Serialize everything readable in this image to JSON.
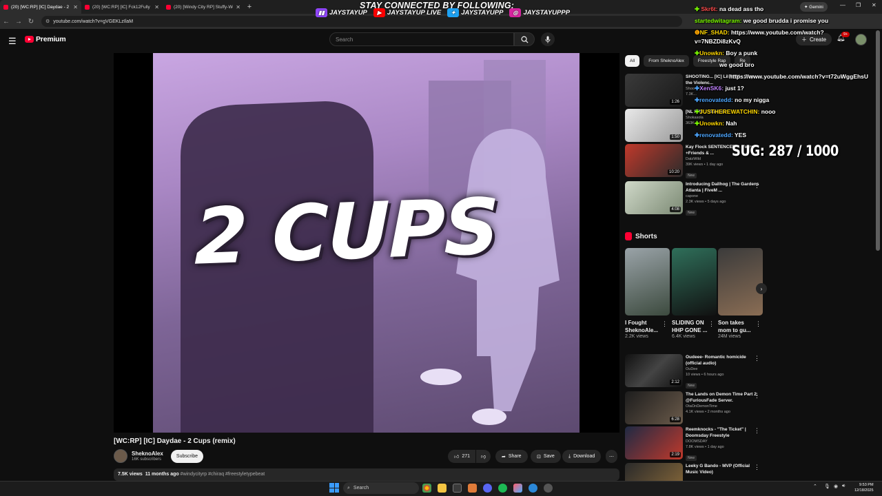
{
  "browser": {
    "tabs": [
      {
        "title": "(20) [WC:RP] [IC] Daydae - 2 Cu",
        "active": true
      },
      {
        "title": "(20) [WC:RP] [IC] Fck12Fully X",
        "active": false
      },
      {
        "title": "(20) [Windy City RP] Stuffy-We",
        "active": false
      }
    ],
    "url": "youtube.com/watch?v=gVGEKLzIlaM",
    "gemini_label": "Gemini"
  },
  "overlay": {
    "title": "STAY CONNECTED BY FOLLOWING:",
    "socials": [
      {
        "icon": "twitch-icon",
        "label": "JAYSTAYUP",
        "color": "#9146ff"
      },
      {
        "icon": "youtube-icon",
        "label": "JAYSTAYUP LIVE",
        "color": "#ff0000"
      },
      {
        "icon": "twitter-icon",
        "label": "JAYSTAYUPP",
        "color": "#1da1f2"
      },
      {
        "icon": "instagram-icon",
        "label": "JAYSTAYUPPP",
        "color": "#d6249f"
      }
    ],
    "suggestion": "SUG:  287 / 1000",
    "chat": [
      {
        "user": "Skr6t:",
        "msg": "na dead ass tho",
        "color": "#ff4d4d"
      },
      {
        "user": "startedwitagram:",
        "msg": "we good brudda i promise you",
        "color": "#7cfc00"
      },
      {
        "user": "NF_SHAD:",
        "msg": "https://www.youtube.com/watch?",
        "color": "#ffd700"
      },
      {
        "user": "",
        "msg": "v=7NBZDi8zKvQ",
        "color": "#ffffff"
      },
      {
        "user": "Unowkn:",
        "msg": "Boy a punk",
        "color": "#ffd700"
      },
      {
        "user": "",
        "msg": "we good bro",
        "color": "#ffffff"
      },
      {
        "user": "",
        "msg": "https://www.youtube.com/watch?v=t72uWggEhsU",
        "color": "#ffffff"
      },
      {
        "user": "XenSK6:",
        "msg": "just 1?",
        "color": "#c080ff"
      },
      {
        "user": "renovatedd:",
        "msg": "no my nigga",
        "color": "#4da6ff"
      },
      {
        "user": "JUSTHEREWATCHIN:",
        "msg": "nooo",
        "color": "#ffd700"
      },
      {
        "user": "Unowkn:",
        "msg": "Nah",
        "color": "#ffd700"
      },
      {
        "user": "renovatedd:",
        "msg": "YES",
        "color": "#4da6ff"
      }
    ]
  },
  "youtube": {
    "logo_label": "Premium",
    "search_placeholder": "Search",
    "create_label": "Create",
    "notif_count": "9+",
    "video": {
      "overlay_text": "2 CUPS",
      "title": "[WC:RP] [IC] Daydae - 2 Cups (remix)",
      "channel": "SheknoAlex",
      "subscribers": "16K subscribers",
      "subscribe_label": "Subscribe",
      "likes": "271",
      "share_label": "Share",
      "save_label": "Save",
      "download_label": "Download",
      "views": "7.5K views",
      "age": "11 months ago",
      "tags": "#windycityrp #chiraq #freestyletypebeat"
    },
    "chips": [
      "All",
      "From SheknoAlex",
      "Freestyle Rap",
      "Re"
    ],
    "recs": [
      {
        "title": "SHOOTING... [IC] Lil BAM - Stop the Violenc...",
        "channel": "Shoo...",
        "meta": "7.3K...",
        "duration": "1:26",
        "badge": ""
      },
      {
        "title": "[NL RP] ... Violence",
        "channel": "Shokasola",
        "meta": "363K...",
        "duration": "1:50",
        "badge": ""
      },
      {
        "title": "Kay Flock SENTENCED ... Years! +Friends & ...",
        "channel": "DatzWild",
        "meta": "39K views • 1 day ago",
        "duration": "10:20",
        "badge": "New"
      },
      {
        "title": "Introducing Dallhog | The Gardens Atlanta | FiveM ...",
        "channel": "capone",
        "meta": "2.3K views • 5 days ago",
        "duration": "4:08",
        "badge": "New"
      }
    ],
    "shorts_label": "Shorts",
    "shorts": [
      {
        "title": "I Fought SheknoAle...",
        "views": "2.2K views"
      },
      {
        "title": "SLIDING ON HHP GONE ...",
        "views": "6.4K views"
      },
      {
        "title": "Son takes mom to gu...",
        "views": "24M views"
      }
    ],
    "recs2": [
      {
        "title": "Oudeee- Romantic homicide (official audio)",
        "channel": "OuDee",
        "meta": "10 views • 6 hours ago",
        "duration": "2:12",
        "badge": "New"
      },
      {
        "title": "The Lands on Demon Time Part 2. @FuriousFade Server.",
        "channel": "OtaOnDemonTime",
        "meta": "4.1K views • 2 months ago",
        "duration": "6:28",
        "badge": ""
      },
      {
        "title": "Reemknocks - \"The Ticket\" | Doomsday Freestyle",
        "channel": "DOOMSDAY",
        "meta": "7.8K views • 1 day ago",
        "duration": "2:19",
        "badge": "New"
      },
      {
        "title": "Leeky G Bando - MVP (Official Music Video)",
        "channel": "",
        "meta": "",
        "duration": "",
        "badge": ""
      }
    ]
  },
  "taskbar": {
    "search_label": "Search",
    "time": "9:53 PM",
    "date": "12/18/2025"
  }
}
